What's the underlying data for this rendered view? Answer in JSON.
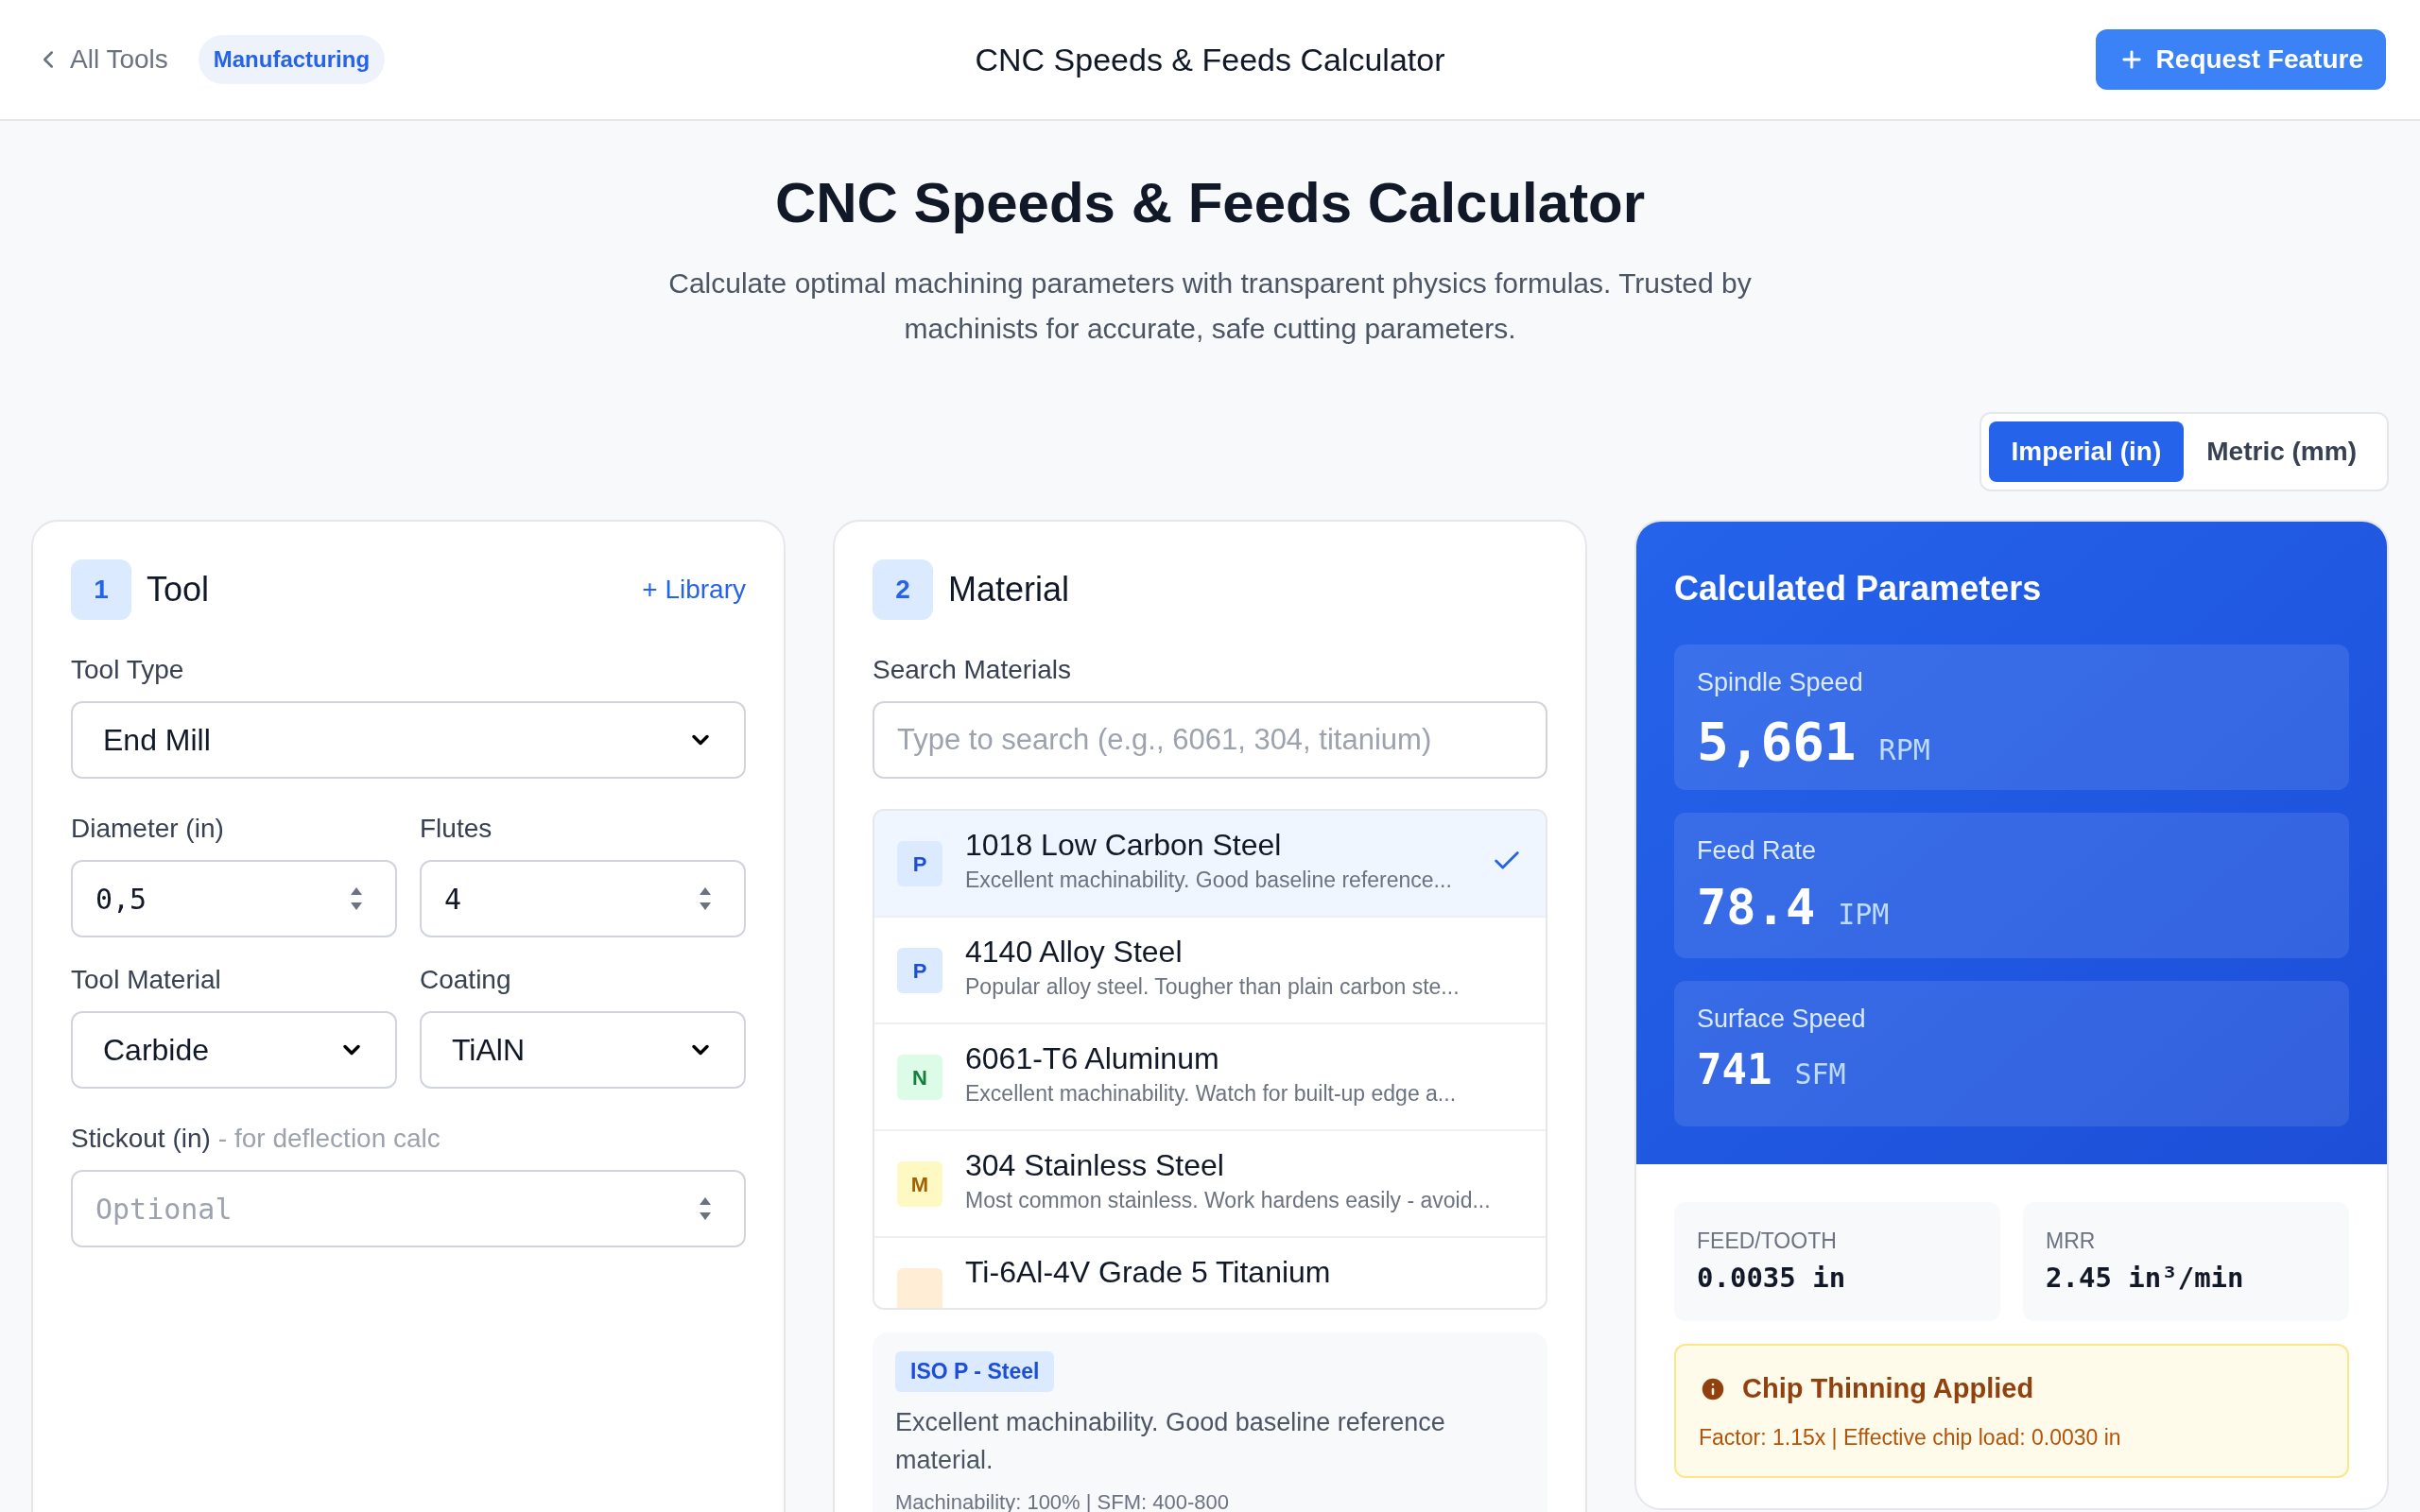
{
  "header": {
    "back_link": "All Tools",
    "category_badge": "Manufacturing",
    "title": "CNC Speeds & Feeds Calculator",
    "action_button": "Request Feature"
  },
  "hero": {
    "title": "CNC Speeds & Feeds Calculator",
    "subtitle": "Calculate optimal machining parameters with transparent physics formulas. Trusted by machinists for accurate, safe cutting parameters."
  },
  "units": [
    {
      "label": "Imperial (in)",
      "selected": true
    },
    {
      "label": "Metric (mm)",
      "selected": false
    }
  ],
  "tool_card": {
    "step": "1",
    "title": "Tool",
    "library_link": "+ Library",
    "tool_type": {
      "label": "Tool Type",
      "value": "End Mill"
    },
    "diameter": {
      "label": "Diameter (in)",
      "value": "0,5"
    },
    "flutes": {
      "label": "Flutes",
      "value": "4"
    },
    "tool_material": {
      "label": "Tool Material",
      "value": "Carbide"
    },
    "coating": {
      "label": "Coating",
      "value": "TiAlN"
    },
    "stickout": {
      "label": "Stickout (in)",
      "hint": "- for deflection calc",
      "placeholder": "Optional"
    }
  },
  "material_card": {
    "step": "2",
    "title": "Material",
    "search": {
      "label": "Search Materials",
      "placeholder": "Type to search (e.g., 6061, 304, titanium)"
    },
    "materials": [
      {
        "grade": "P",
        "color": "#dbeafe",
        "name": "1018 Low Carbon Steel",
        "description": "Excellent machinability. Good baseline reference...",
        "selected": true
      },
      {
        "grade": "P",
        "color": "#dbeafe",
        "name": "4140 Alloy Steel",
        "description": "Popular alloy steel. Tougher than plain carbon ste...",
        "selected": false
      },
      {
        "grade": "N",
        "color": "#dcfce7",
        "name": "6061-T6 Aluminum",
        "description": "Excellent machinability. Watch for built-up edge a...",
        "selected": false
      },
      {
        "grade": "M",
        "color": "#fef9c3",
        "name": "304 Stainless Steel",
        "description": "Most common stainless. Work hardens easily - avoid...",
        "selected": false
      },
      {
        "color": "#ffedd5",
        "name": "Ti-6Al-4V Grade 5 Titanium",
        "selected": false
      }
    ],
    "details": {
      "tag": "ISO P - Steel",
      "description": "Excellent machinability. Good baseline reference material.",
      "stats": "Machinability: 100% | SFM: 400-800"
    }
  },
  "results": {
    "title": "Calculated Parameters",
    "primary": [
      {
        "label": "Spindle Speed",
        "value": "5,661",
        "unit": "RPM"
      },
      {
        "label": "Feed Rate",
        "value": "78.4",
        "unit": "IPM"
      },
      {
        "label": "Surface Speed",
        "value": "741",
        "unit": "SFM"
      }
    ],
    "secondary": [
      {
        "label": "FEED/TOOTH",
        "value": "0.0035 in"
      },
      {
        "label": "MRR",
        "value": "2.45 in³/min"
      }
    ],
    "notice": {
      "title": "Chip Thinning Applied",
      "text": "Factor: 1.15x | Effective chip load: 0.0030 in"
    }
  }
}
